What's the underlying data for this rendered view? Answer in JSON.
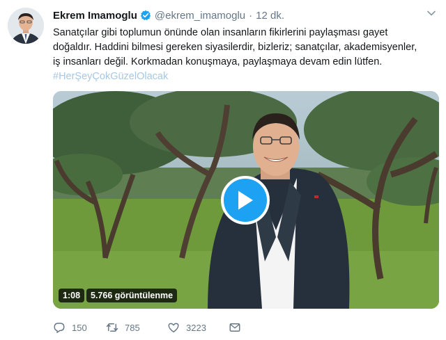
{
  "author": {
    "name": "Ekrem Imamoglu",
    "handle": "@ekrem_imamoglu",
    "separator": "·",
    "time": "12 dk."
  },
  "tweet": {
    "lines": [
      "Sanatçılar gibi toplumun önünde olan insanların fikirlerini paylaşması gayet",
      "doğaldır. Haddini bilmesi gereken siyasilerdir, bizleriz;  sanatçılar, akademisyenler,",
      "iş insanları değil. Korkmadan konuşmaya, paylaşmaya devam edin lütfen."
    ],
    "hashtag": "#HerŞeyÇokGüzelOlacak"
  },
  "video": {
    "duration": "1:08",
    "views": "5.766 görüntülenme"
  },
  "actions": {
    "reply_count": "150",
    "retweet_count": "785",
    "like_count": "3223"
  },
  "colors": {
    "accent": "#1da1f2",
    "hashtag": "#a7c7e4",
    "muted": "#657786"
  }
}
